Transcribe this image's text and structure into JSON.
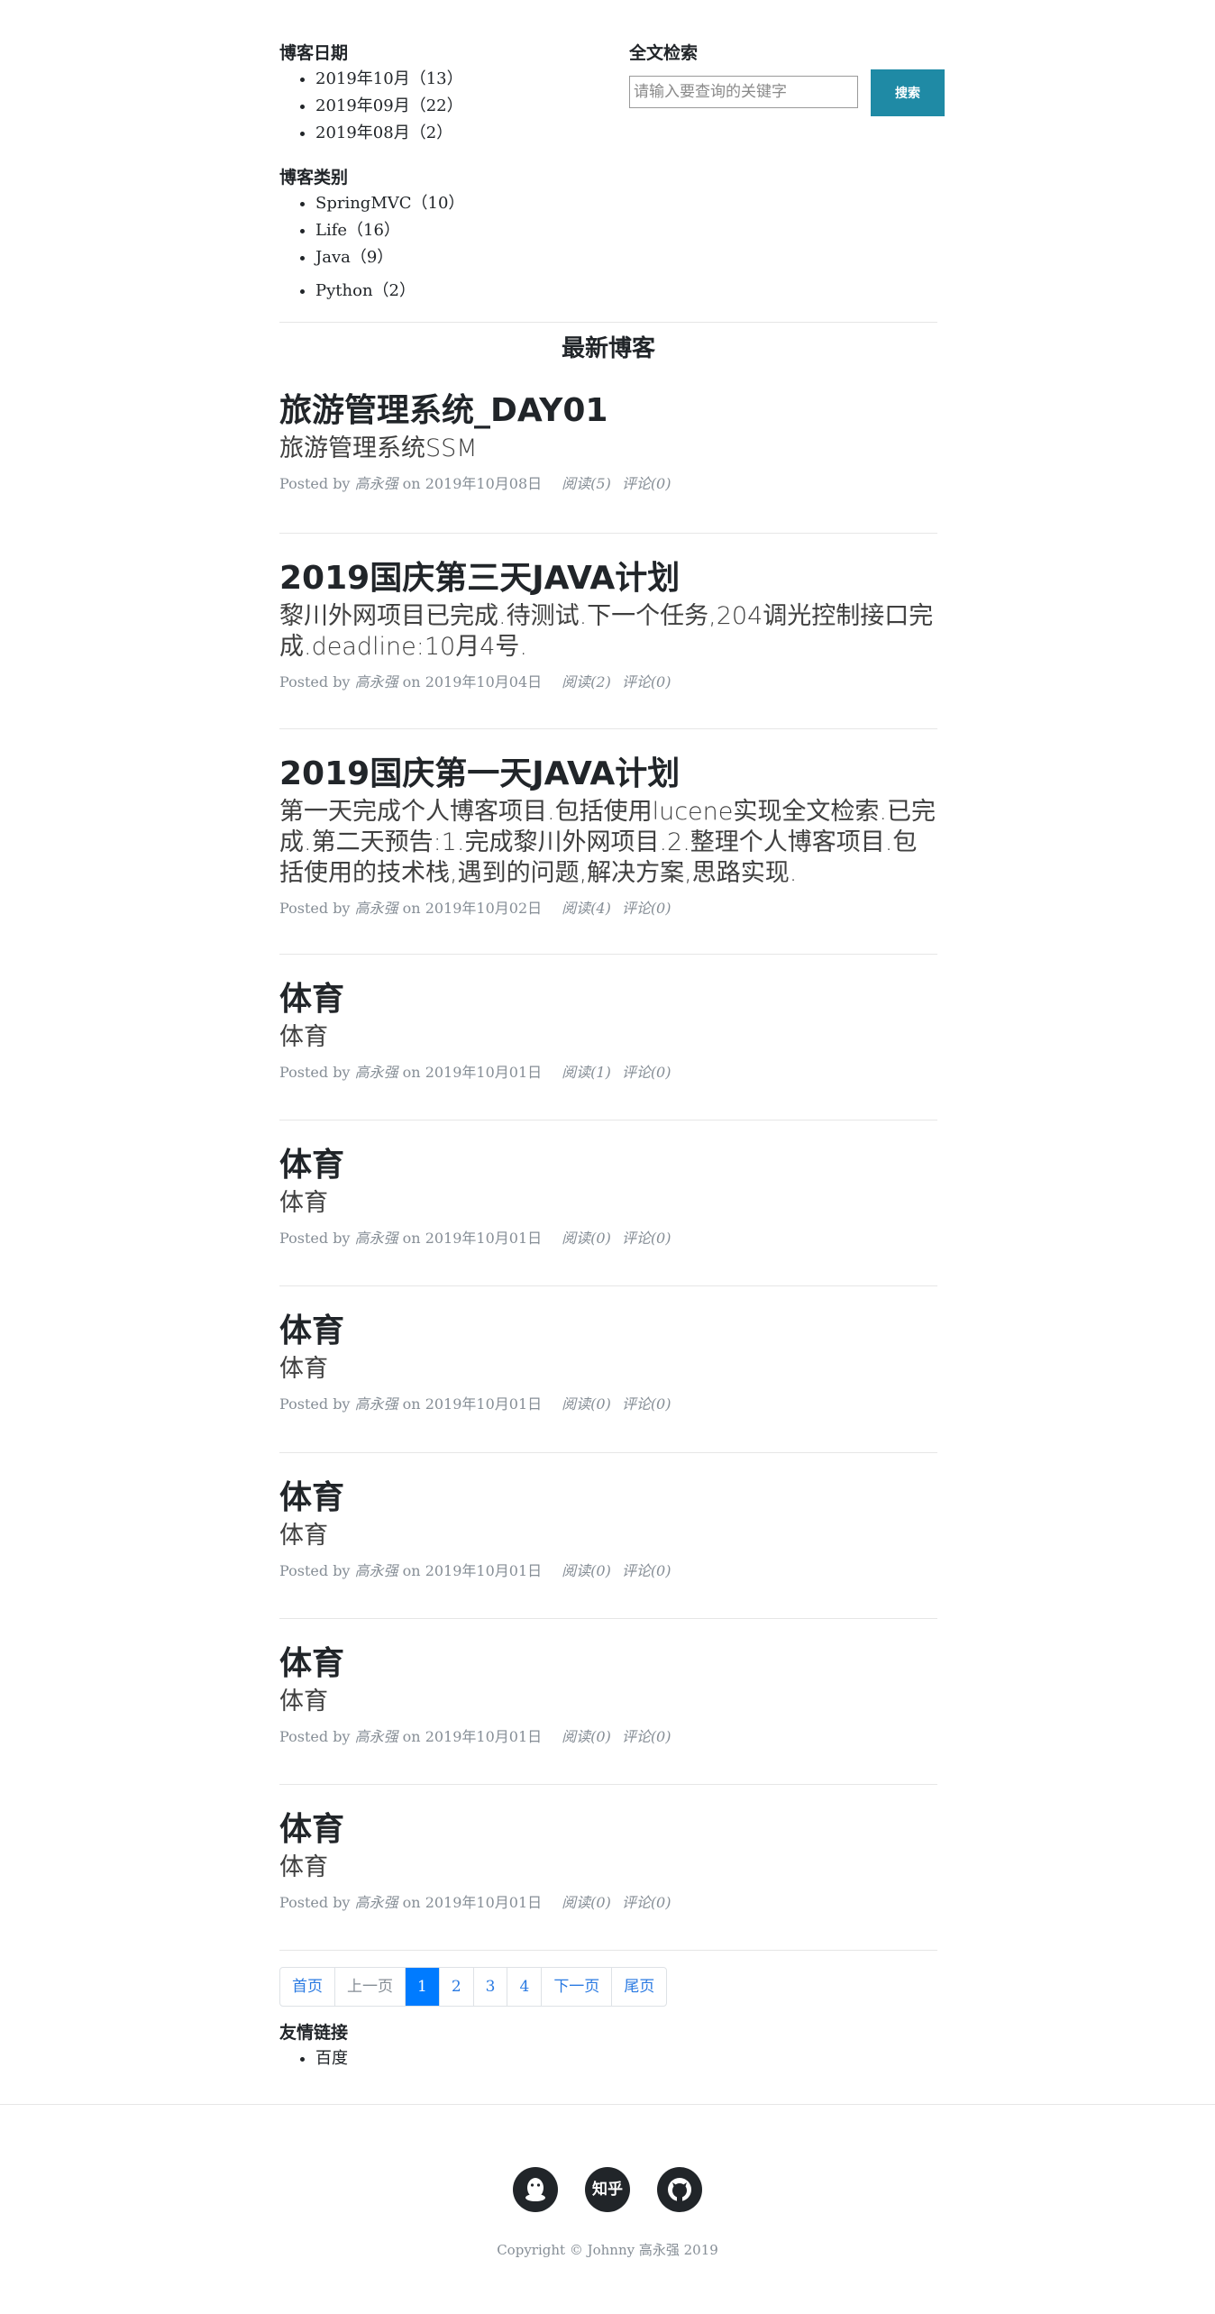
{
  "sidebar": {
    "dates_heading": "博客日期",
    "dates": [
      "2019年10月（13）",
      "2019年09月（22）",
      "2019年08月（2）"
    ],
    "categories_heading": "博客类别",
    "categories": [
      "SpringMVC（10）",
      "Life（16）",
      "Java（9）",
      "Python（2）"
    ]
  },
  "search": {
    "heading": "全文检索",
    "placeholder": "请输入要查询的关键字",
    "button": "搜索"
  },
  "section_title": "最新博客",
  "posts": [
    {
      "title": "旅游管理系统_DAY01",
      "subtitle": "旅游管理系统SSM",
      "posted_by": "Posted by",
      "author": "高永强",
      "on": "on 2019年10月08日",
      "read": "阅读(5)",
      "comment": "评论(0)"
    },
    {
      "title": "2019国庆第三天JAVA计划",
      "subtitle": "黎川外网项目已完成.待测试.下一个任务,204调光控制接口完成.deadline:10月4号.",
      "posted_by": "Posted by",
      "author": "高永强",
      "on": "on 2019年10月04日",
      "read": "阅读(2)",
      "comment": "评论(0)"
    },
    {
      "title": "2019国庆第一天JAVA计划",
      "subtitle": "第一天完成个人博客项目.包括使用lucene实现全文检索.已完成.第二天预告:1.完成黎川外网项目.2.整理个人博客项目.包括使用的技术栈,遇到的问题,解决方案,思路实现.",
      "posted_by": "Posted by",
      "author": "高永强",
      "on": "on 2019年10月02日",
      "read": "阅读(4)",
      "comment": "评论(0)"
    },
    {
      "title": "体育",
      "subtitle": "体育",
      "posted_by": "Posted by",
      "author": "高永强",
      "on": "on 2019年10月01日",
      "read": "阅读(1)",
      "comment": "评论(0)"
    },
    {
      "title": "体育",
      "subtitle": "体育",
      "posted_by": "Posted by",
      "author": "高永强",
      "on": "on 2019年10月01日",
      "read": "阅读(0)",
      "comment": "评论(0)"
    },
    {
      "title": "体育",
      "subtitle": "体育",
      "posted_by": "Posted by",
      "author": "高永强",
      "on": "on 2019年10月01日",
      "read": "阅读(0)",
      "comment": "评论(0)"
    },
    {
      "title": "体育",
      "subtitle": "体育",
      "posted_by": "Posted by",
      "author": "高永强",
      "on": "on 2019年10月01日",
      "read": "阅读(0)",
      "comment": "评论(0)"
    },
    {
      "title": "体育",
      "subtitle": "体育",
      "posted_by": "Posted by",
      "author": "高永强",
      "on": "on 2019年10月01日",
      "read": "阅读(0)",
      "comment": "评论(0)"
    },
    {
      "title": "体育",
      "subtitle": "体育",
      "posted_by": "Posted by",
      "author": "高永强",
      "on": "on 2019年10月01日",
      "read": "阅读(0)",
      "comment": "评论(0)"
    }
  ],
  "pagination": {
    "first": "首页",
    "prev": "上一页",
    "pages": [
      "1",
      "2",
      "3",
      "4"
    ],
    "current": "1",
    "next": "下一页",
    "last": "尾页"
  },
  "links": {
    "heading": "友情链接",
    "items": [
      "百度"
    ]
  },
  "footer": {
    "social": [
      {
        "icon": "qq-icon",
        "label": ""
      },
      {
        "icon": "zhihu-icon",
        "label": "知乎"
      },
      {
        "icon": "github-icon",
        "label": ""
      }
    ],
    "copyright": "Copyright © Johnny 高永强 2019"
  },
  "colors": {
    "search_button": "#1f8aa5",
    "page_active": "#007bff",
    "link": "#2a7ae2",
    "meta": "#868e96"
  }
}
